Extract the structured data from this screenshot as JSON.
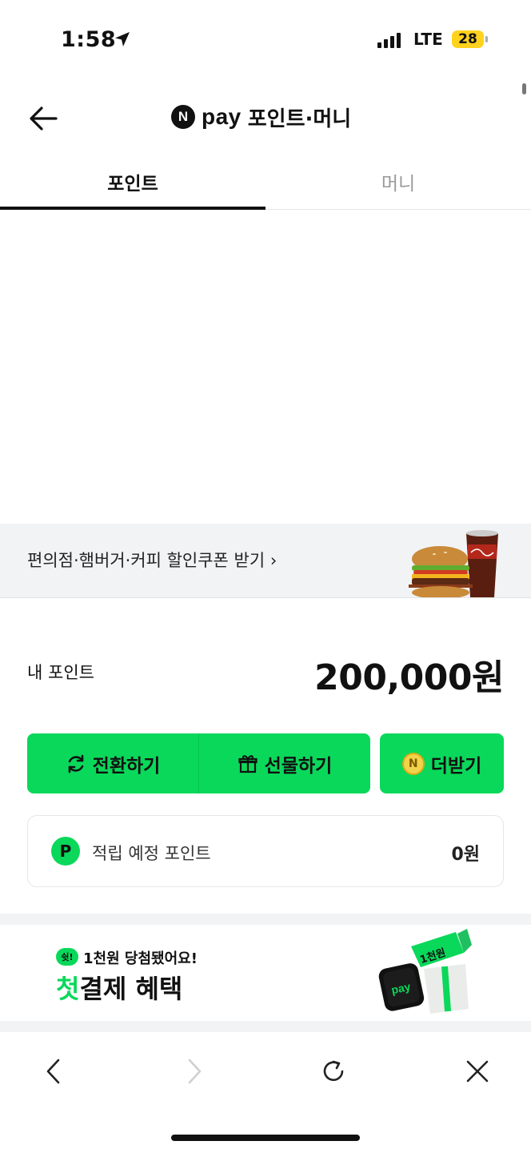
{
  "status_bar": {
    "time": "1:58",
    "network": "LTE",
    "battery": "28",
    "battery_color": "#ffd21e"
  },
  "header": {
    "logo_letter": "N",
    "logo_word": "pay",
    "title": "포인트·머니",
    "back_icon": "arrow-left-icon"
  },
  "tabs": [
    {
      "label": "포인트",
      "active": true
    },
    {
      "label": "머니",
      "active": false
    }
  ],
  "coupon_banner": {
    "text": "편의점·햄버거·커피 할인쿠폰 받기 ›"
  },
  "points": {
    "label": "내 포인트",
    "value": "200,000원"
  },
  "actions": {
    "convert_label": "전환하기",
    "convert_icon": "refresh-icon",
    "gift_label": "선물하기",
    "gift_icon": "gift-icon",
    "more_label": "더받기",
    "more_icon": "coin-icon",
    "coin_letter": "N"
  },
  "pending": {
    "badge": "P",
    "label": "적립 예정 포인트",
    "value": "0원"
  },
  "promo": {
    "badge": "쉿!",
    "subtitle": "1천원 당첨됐어요!",
    "title_highlight": "첫",
    "title_rest": "결제 혜택",
    "gift_tag": "1천원",
    "phone_word": "pay"
  },
  "toolbar": {
    "back_icon": "chevron-left-icon",
    "forward_icon": "chevron-right-icon",
    "reload_icon": "reload-icon",
    "close_icon": "close-icon"
  },
  "colors": {
    "brand_green": "#0ad85a",
    "text_dark": "#111111",
    "text_muted": "#9a9a9a"
  }
}
